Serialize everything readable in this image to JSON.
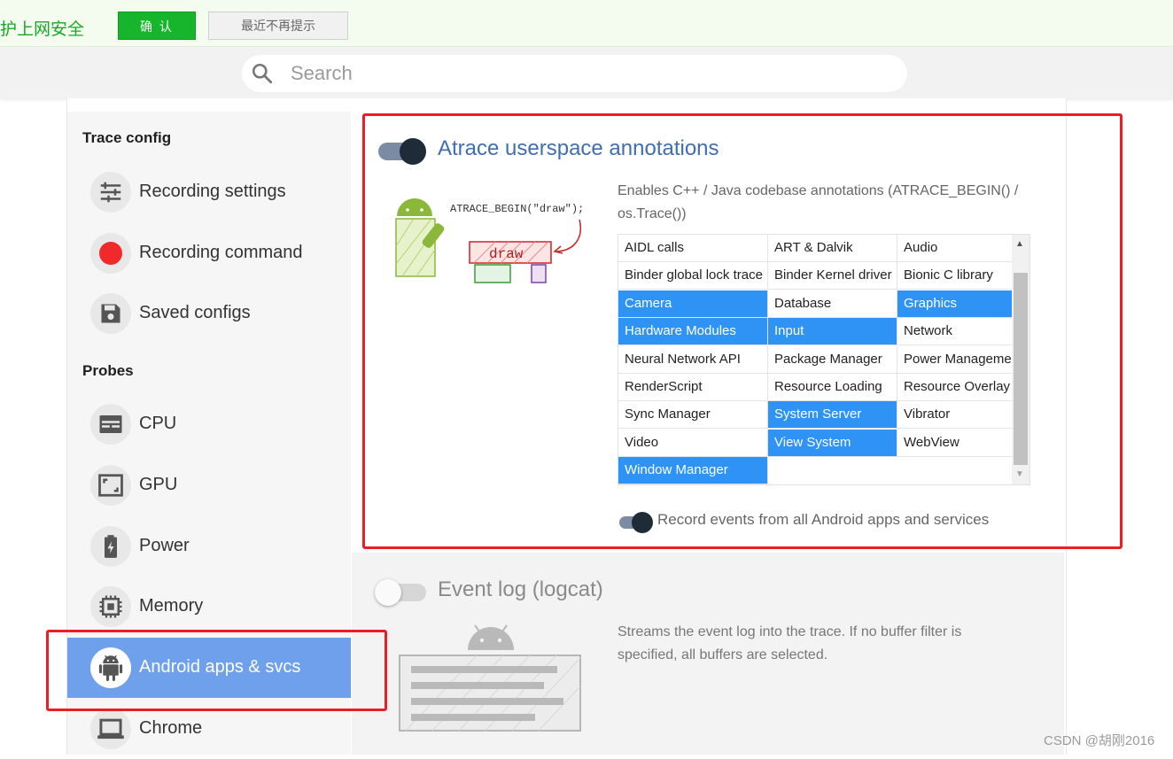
{
  "notice": {
    "text": "护上网安全",
    "confirm_label": "确 认",
    "dismiss_label": "最近不再提示"
  },
  "search": {
    "placeholder": "Search"
  },
  "sidebar": {
    "trace_config_title": "Trace config",
    "trace_items": [
      {
        "label": "Recording settings",
        "icon": "tune-sliders-icon"
      },
      {
        "label": "Recording command",
        "icon": "record-dot-icon"
      },
      {
        "label": "Saved configs",
        "icon": "floppy-disk-icon"
      }
    ],
    "probes_title": "Probes",
    "probe_items": [
      {
        "label": "CPU",
        "icon": "cpu-icon"
      },
      {
        "label": "GPU",
        "icon": "gpu-icon"
      },
      {
        "label": "Power",
        "icon": "battery-icon"
      },
      {
        "label": "Memory",
        "icon": "memory-chip-icon"
      },
      {
        "label": "Android apps & svcs",
        "icon": "android-icon",
        "active": true
      },
      {
        "label": "Chrome",
        "icon": "laptop-icon"
      }
    ]
  },
  "atrace": {
    "title": "Atrace userspace annotations",
    "enabled": true,
    "description": "Enables C++ / Java codebase annotations (ATRACE_BEGIN() / os.Trace())",
    "illustration": {
      "code_text": "ATRACE_BEGIN(\"draw\");",
      "block_label": "draw"
    },
    "categories": [
      {
        "label": "AIDL calls",
        "selected": false
      },
      {
        "label": "ART & Dalvik",
        "selected": false
      },
      {
        "label": "Audio",
        "selected": false
      },
      {
        "label": "Binder global lock trace",
        "selected": false
      },
      {
        "label": "Binder Kernel driver",
        "selected": false
      },
      {
        "label": "Bionic C library",
        "selected": false
      },
      {
        "label": "Camera",
        "selected": true
      },
      {
        "label": "Database",
        "selected": false
      },
      {
        "label": "Graphics",
        "selected": true
      },
      {
        "label": "Hardware Modules",
        "selected": true
      },
      {
        "label": "Input",
        "selected": true
      },
      {
        "label": "Network",
        "selected": false
      },
      {
        "label": "Neural Network API",
        "selected": false
      },
      {
        "label": "Package Manager",
        "selected": false
      },
      {
        "label": "Power Manageme",
        "selected": false
      },
      {
        "label": "RenderScript",
        "selected": false
      },
      {
        "label": "Resource Loading",
        "selected": false
      },
      {
        "label": "Resource Overlay",
        "selected": false
      },
      {
        "label": "Sync Manager",
        "selected": false
      },
      {
        "label": "System Server",
        "selected": true
      },
      {
        "label": "Vibrator",
        "selected": false
      },
      {
        "label": "Video",
        "selected": false
      },
      {
        "label": "View System",
        "selected": true
      },
      {
        "label": "WebView",
        "selected": false
      },
      {
        "label": "Window Manager",
        "selected": true
      }
    ],
    "record_all_label": "Record events from all Android apps and services",
    "record_all_enabled": true
  },
  "logcat": {
    "title": "Event log (logcat)",
    "enabled": false,
    "description": "Streams the event log into the trace. If no buffer filter is specified, all buffers are selected."
  },
  "watermark": "CSDN @胡刚2016",
  "colors": {
    "accent": "#3f6fb0",
    "selected_cell": "#2f93f5",
    "active_nav": "#6fa0eb",
    "toggle_on_knob": "#202b38",
    "highlight_box": "#ee1c24",
    "notice_green": "#16b52b"
  }
}
